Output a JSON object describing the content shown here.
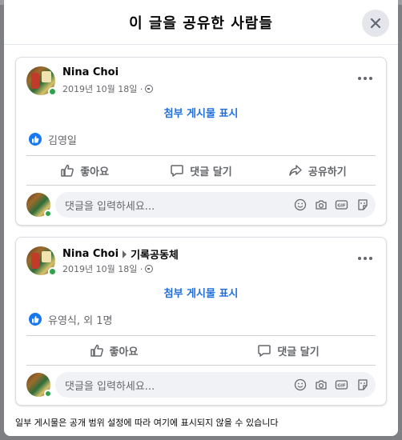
{
  "modal": {
    "title": "이 글을 공유한 사람들",
    "footer_note": "일부 게시물은 공개 범위 설정에 따라 여기에 표시되지 않을 수 있습니다"
  },
  "posts": [
    {
      "author": "Nina Choi",
      "target": "",
      "date": "2019년 10월 18일 ·",
      "privacy_icon": "globe-icon",
      "attachment_link": "첨부 게시물 표시",
      "reactions": "김영일",
      "actions": {
        "like": "좋아요",
        "comment": "댓글 달기",
        "share": "공유하기"
      },
      "comment_placeholder": "댓글을 입력하세요..."
    },
    {
      "author": "Nina Choi",
      "target": "기록공동체",
      "date": "2019년 10월 18일 ·",
      "privacy_icon": "group-icon",
      "attachment_link": "첨부 게시물 표시",
      "reactions": "유영식, 외 1명",
      "actions": {
        "like": "좋아요",
        "comment": "댓글 달기"
      },
      "comment_placeholder": "댓글을 입력하세요..."
    }
  ],
  "colors": {
    "link_blue": "#216fdb",
    "like_blue": "#1877f2",
    "online_green": "#31a24c"
  }
}
